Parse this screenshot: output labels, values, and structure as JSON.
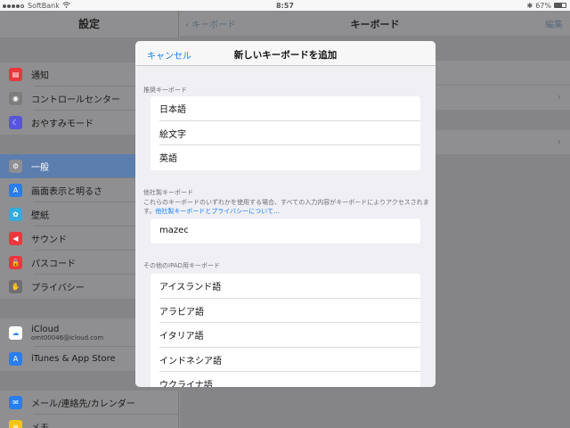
{
  "status_bar": {
    "carrier": "SoftBank",
    "time": "8:57",
    "battery": "67%",
    "battery_level": 0.67
  },
  "sidebar": {
    "title": "設定",
    "group1": [
      {
        "label": "通知",
        "icon": "notifications-icon",
        "color": "#e5393d"
      },
      {
        "label": "コントロールセンター",
        "icon": "control-center-icon",
        "color": "#7d7d7d"
      },
      {
        "label": "おやすみモード",
        "icon": "moon-icon",
        "color": "#5856d6"
      }
    ],
    "group2": [
      {
        "label": "一般",
        "icon": "gear-icon",
        "color": "#8e8e93",
        "selected": true
      },
      {
        "label": "画面表示と明るさ",
        "icon": "brightness-icon",
        "color": "#2b7de9"
      },
      {
        "label": "壁紙",
        "icon": "wallpaper-icon",
        "color": "#36aadc"
      },
      {
        "label": "サウンド",
        "icon": "sound-icon",
        "color": "#e5393d"
      },
      {
        "label": "パスコード",
        "icon": "lock-icon",
        "color": "#e5393d"
      },
      {
        "label": "プライバシー",
        "icon": "hand-icon",
        "color": "#6d6d72"
      }
    ],
    "group3": [
      {
        "label": "iCloud",
        "sub": "omt00046@icloud.com",
        "icon": "icloud-icon",
        "color": "#ffffff"
      },
      {
        "label": "iTunes & App Store",
        "icon": "app-store-icon",
        "color": "#2b7de9"
      }
    ],
    "group4": [
      {
        "label": "メール/連絡先/カレンダー",
        "icon": "mail-icon",
        "color": "#2b7de9"
      },
      {
        "label": "メモ",
        "icon": "notes-icon",
        "color": "#f5c419"
      }
    ]
  },
  "right_pane": {
    "back_label": "キーボード",
    "title": "キーボード",
    "edit_label": "編集"
  },
  "modal": {
    "cancel_label": "キャンセル",
    "title": "新しいキーボードを追加",
    "recommended_header": "推奨キーボード",
    "recommended": [
      "日本語",
      "絵文字",
      "英語"
    ],
    "third_party_header": "他社製キーボード",
    "third_party_desc": "これらのキーボードのいずれかを使用する場合、すべての入力内容がキーボードによりアクセスされます。",
    "third_party_link": "他社製キーボードとプライバシーについて…",
    "third_party": [
      "mazec"
    ],
    "other_header": "その他のIPAD用キーボード",
    "other": [
      "アイスランド語",
      "アラビア語",
      "イタリア語",
      "インドネシア語",
      "ウクライナ語"
    ]
  }
}
